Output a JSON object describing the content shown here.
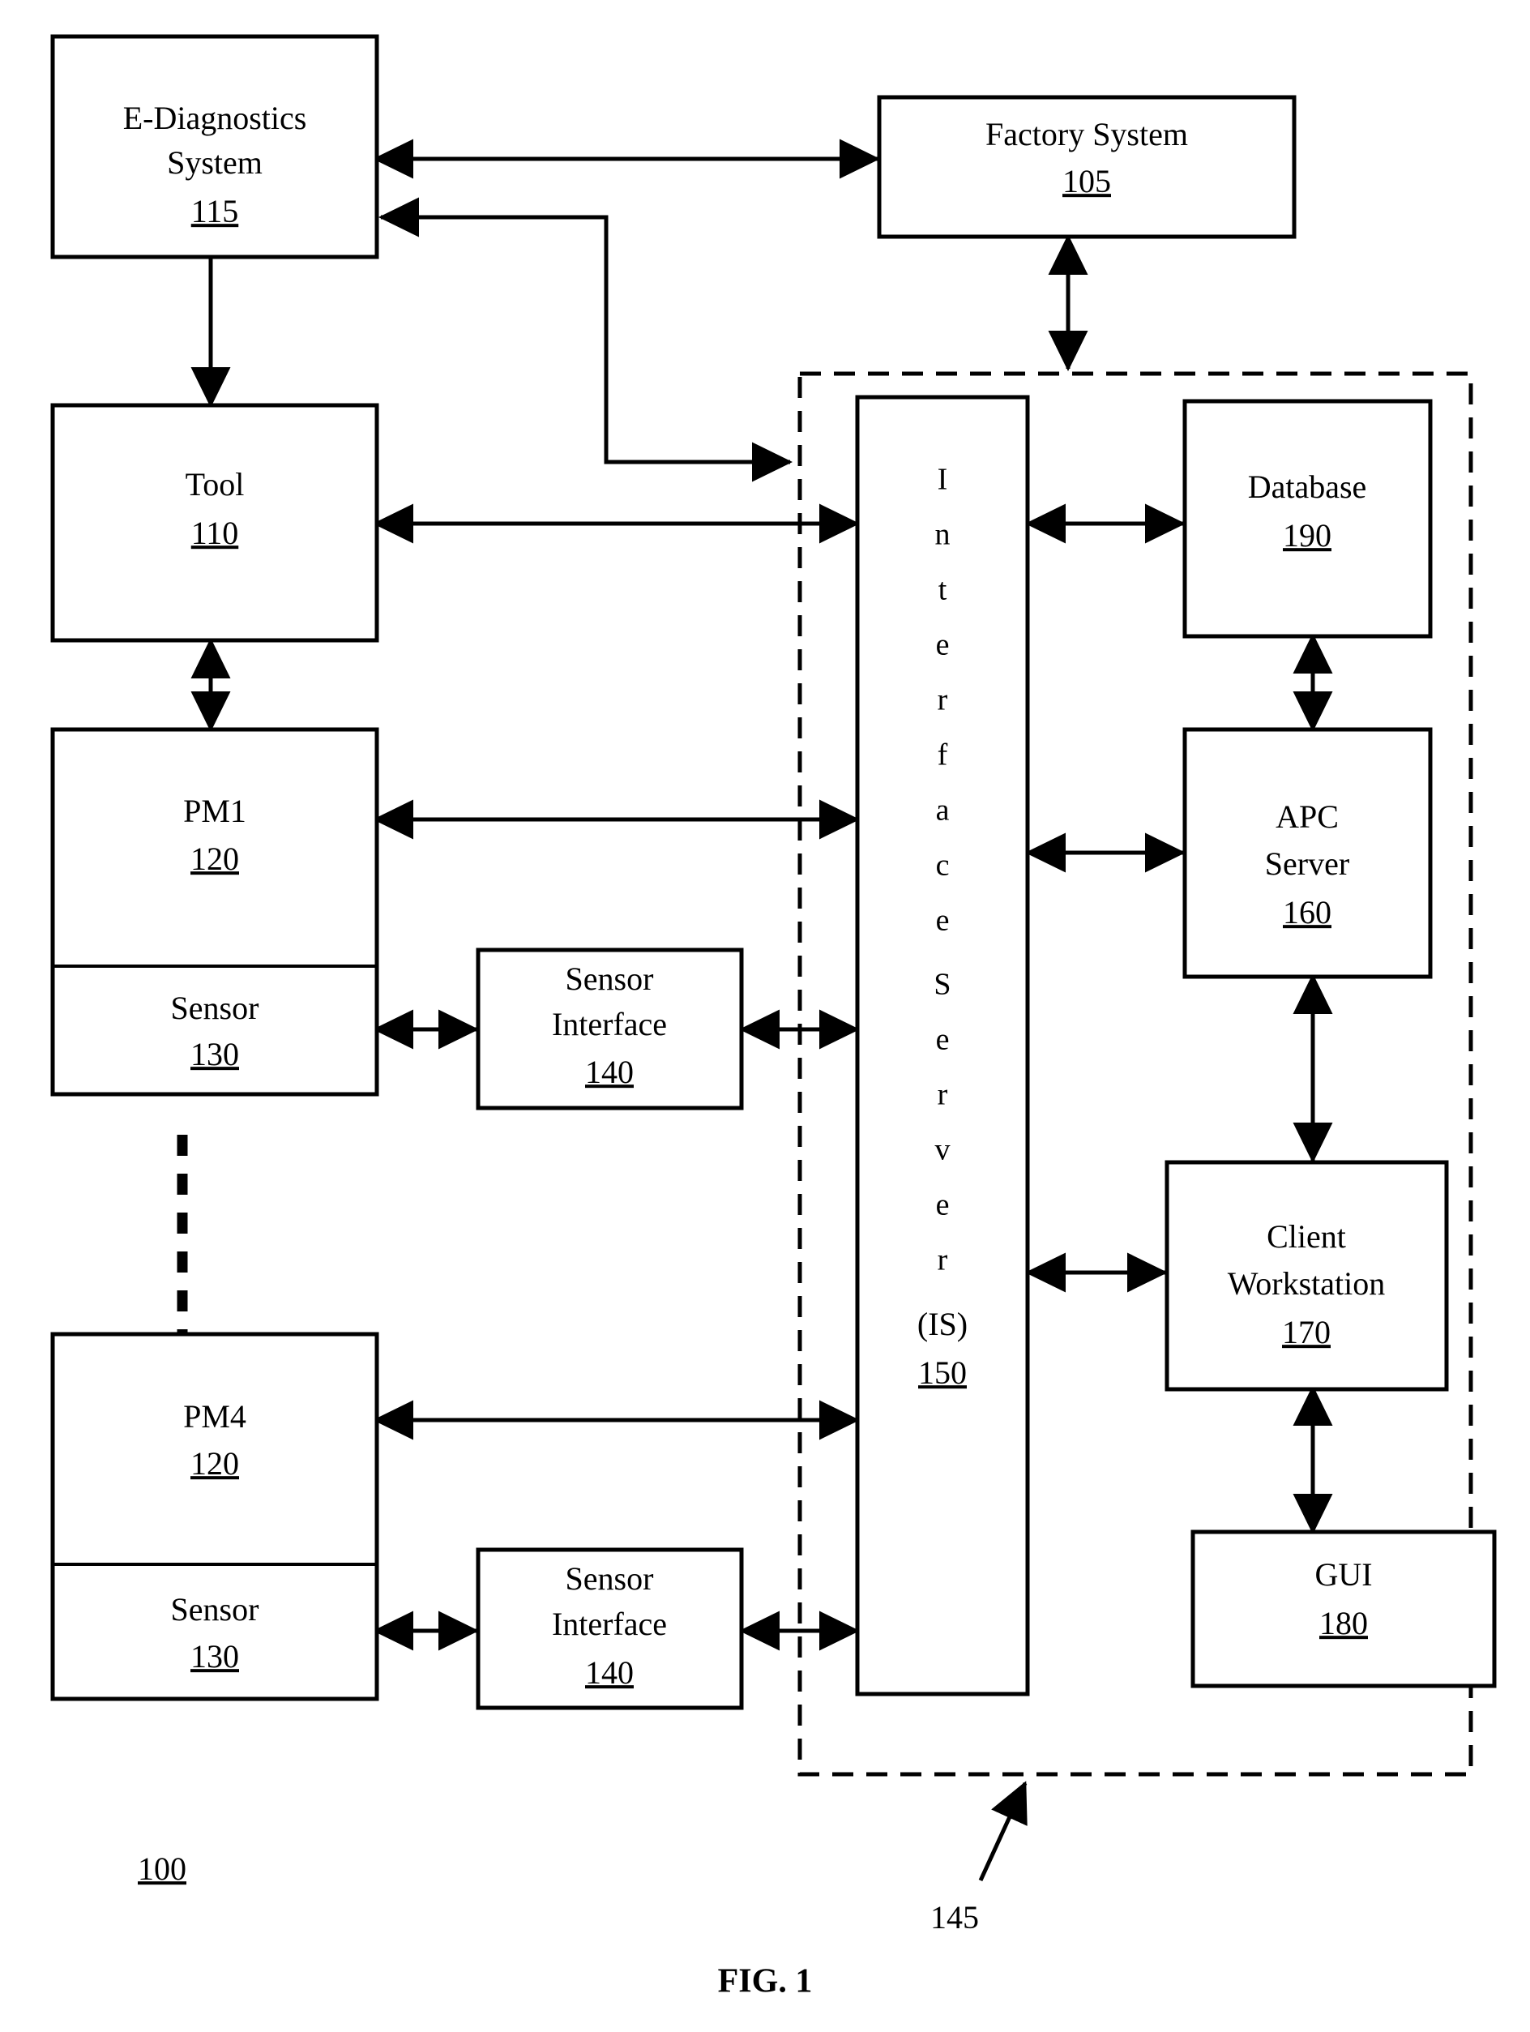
{
  "figure": {
    "caption": "FIG. 1",
    "system_ref": "100",
    "boundary_ref": "145"
  },
  "blocks": [
    {
      "id": "edx",
      "title_line1": "E-Diagnostics",
      "title_line2": "System",
      "ref": "115"
    },
    {
      "id": "factory",
      "title_line1": "Factory System",
      "title_line2": "",
      "ref": "105"
    },
    {
      "id": "tool",
      "title_line1": "Tool",
      "title_line2": "",
      "ref": "110"
    },
    {
      "id": "pm1",
      "title_line1": "PM1",
      "title_line2": "",
      "ref": "120"
    },
    {
      "id": "sensor1",
      "title_line1": "Sensor",
      "title_line2": "",
      "ref": "130"
    },
    {
      "id": "sensorif1",
      "title_line1": "Sensor",
      "title_line2": "Interface",
      "ref": "140"
    },
    {
      "id": "pm4",
      "title_line1": "PM4",
      "title_line2": "",
      "ref": "120"
    },
    {
      "id": "sensor4",
      "title_line1": "Sensor",
      "title_line2": "",
      "ref": "130"
    },
    {
      "id": "sensorif4",
      "title_line1": "Sensor",
      "title_line2": "Interface",
      "ref": "140"
    },
    {
      "id": "database",
      "title_line1": "Database",
      "title_line2": "",
      "ref": "190"
    },
    {
      "id": "apc",
      "title_line1": "APC",
      "title_line2": "Server",
      "ref": "160"
    },
    {
      "id": "client",
      "title_line1": "Client",
      "title_line2": "Workstation",
      "ref": "170"
    },
    {
      "id": "gui",
      "title_line1": "GUI",
      "title_line2": "",
      "ref": "180"
    }
  ],
  "interface_server": {
    "vertical_letters": [
      "I",
      "n",
      "t",
      "e",
      "r",
      "f",
      "a",
      "c",
      "e",
      "S",
      "e",
      "r",
      "v",
      "e",
      "r"
    ],
    "abbrev": "(IS)",
    "ref": "150"
  },
  "colors": {
    "line": "#000000",
    "fill": "#ffffff",
    "text": "#000000"
  }
}
